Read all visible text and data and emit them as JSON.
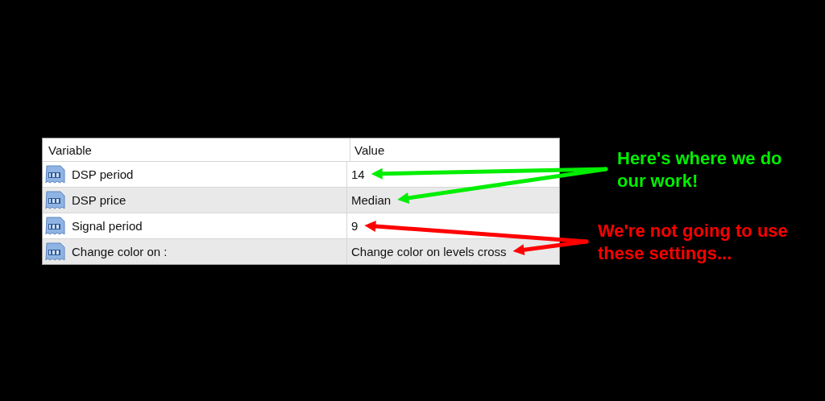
{
  "table": {
    "columns": [
      "Variable",
      "Value"
    ],
    "rows": [
      {
        "variable": "DSP period",
        "value": "14"
      },
      {
        "variable": "DSP price",
        "value": "Median"
      },
      {
        "variable": "Signal period",
        "value": "9"
      },
      {
        "variable": "Change color on :",
        "value": "Change color on levels cross"
      }
    ]
  },
  "annotations": [
    {
      "lines": [
        "Here's where we do",
        "our work!"
      ],
      "color": "#00ee00"
    },
    {
      "lines": [
        "We're not going to use",
        "these settings..."
      ],
      "color": "#ff0000"
    }
  ]
}
